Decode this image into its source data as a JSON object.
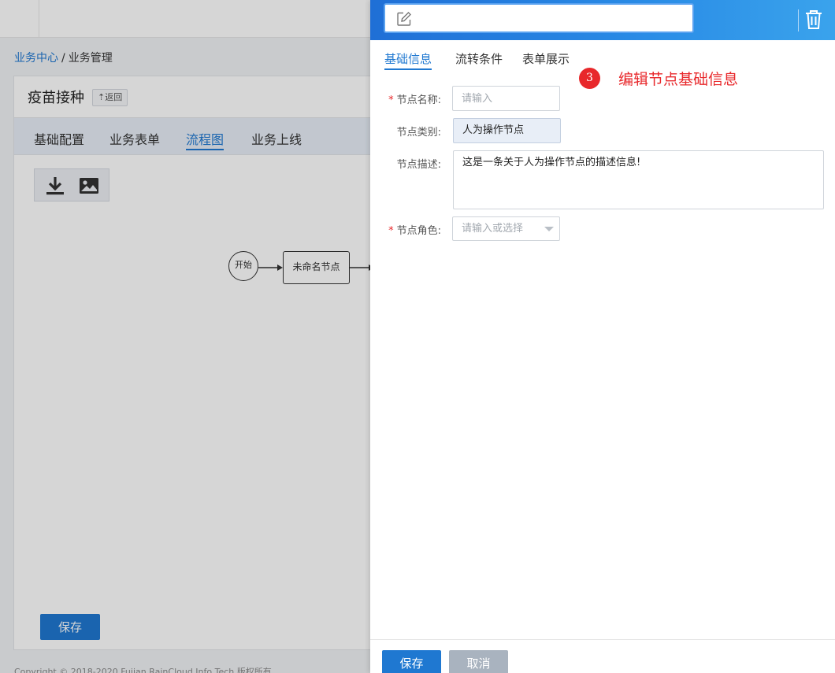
{
  "breadcrumb": {
    "home": "业务中心",
    "separator": "/",
    "current": "业务管理"
  },
  "page": {
    "title": "疫苗接种",
    "back_label": "返回"
  },
  "tabs": [
    {
      "label": "基础配置"
    },
    {
      "label": "业务表单"
    },
    {
      "label": "流程图",
      "active": true
    },
    {
      "label": "业务上线"
    }
  ],
  "toolbar": {
    "download_icon": "download-icon",
    "image_icon": "image-icon"
  },
  "flow": {
    "start_label": "开始",
    "task_label": "未命名节点"
  },
  "bottom": {
    "save_label": "保存"
  },
  "footer": {
    "copyright": "Copyright © 2018-2020 Fujian RainCloud Info Tech 版权所有"
  },
  "drawer": {
    "title_value": "",
    "tabs": [
      {
        "label": "基础信息",
        "active": true
      },
      {
        "label": "流转条件"
      },
      {
        "label": "表单展示"
      }
    ],
    "annotation": {
      "number": "3",
      "text": "编辑节点基础信息"
    },
    "form": {
      "name_label": "节点名称:",
      "name_placeholder": "请输入",
      "type_label": "节点类别:",
      "type_value": "人为操作节点",
      "desc_label": "节点描述:",
      "desc_value": "这是一条关于人为操作节点的描述信息!",
      "role_label": "节点角色:",
      "role_placeholder": "请输入或选择"
    },
    "save_label": "保存",
    "cancel_label": "取消"
  },
  "colors": {
    "primary": "#1f78d1",
    "danger": "#e8282b",
    "header_gradient_end": "#3aa3ec"
  }
}
